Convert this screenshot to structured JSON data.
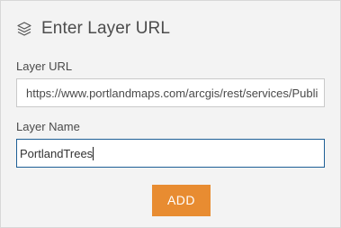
{
  "header": {
    "icon": "layers-icon",
    "title": "Enter Layer URL"
  },
  "form": {
    "layer_url_label": "Layer URL",
    "layer_url_value": "https://www.portlandmaps.com/arcgis/rest/services/Publi",
    "layer_name_label": "Layer Name",
    "layer_name_value": "PortlandTrees"
  },
  "actions": {
    "add_label": "ADD",
    "add_color": "#e88c31"
  },
  "colors": {
    "panel_bg": "#f3f3f3",
    "focused_border": "#1d5f96"
  }
}
